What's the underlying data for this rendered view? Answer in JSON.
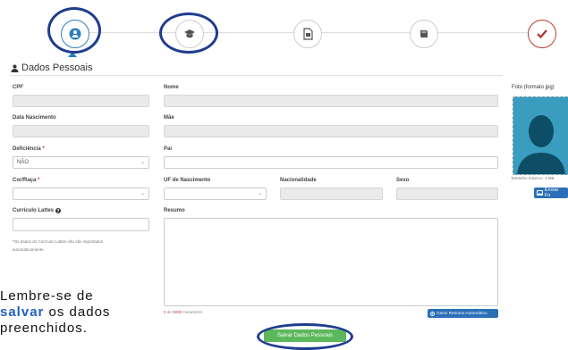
{
  "section": {
    "title": "Dados Pessoais"
  },
  "fields": {
    "cpf": {
      "label": "CPF"
    },
    "nome": {
      "label": "Nome"
    },
    "foto": {
      "label": "Foto (formato jpg)",
      "hint": "Tamanho máximo: 2 MB",
      "button": "Enviar Fo"
    },
    "data_nascimento": {
      "label": "Data Nascimento"
    },
    "mae": {
      "label": "Mãe"
    },
    "deficiencia": {
      "label": "Deficiência",
      "required": "*",
      "value": "NÃO"
    },
    "pai": {
      "label": "Pai"
    },
    "cor_raca": {
      "label": "Cor/Raça",
      "required": "*"
    },
    "uf_nascimento": {
      "label": "UF de Nascimento"
    },
    "nacionalidade": {
      "label": "Nacionalidade"
    },
    "sexo": {
      "label": "Sexo"
    },
    "lattes": {
      "label": "Currículo Lattes",
      "note_line1": "*Os dados do Currículo Lattes não são importados",
      "note_line2": "automaticamente."
    },
    "resumo": {
      "label": "Resumo",
      "counter_num": "0",
      "counter_de": "de",
      "counter_max": "5000",
      "counter_suffix": "Caracteres",
      "generate_button": "Gerar Resumo Automático"
    }
  },
  "save_button": "Salvar Dados Pessoais",
  "reminder": {
    "line1": "Lembre-se de",
    "highlight": "salvar",
    "line2_rest": "os dados",
    "line3": "preenchidos."
  },
  "steps": [
    {
      "icon": "user-icon",
      "active": true
    },
    {
      "icon": "graduation-cap-icon",
      "active": false
    },
    {
      "icon": "document-icon",
      "active": false
    },
    {
      "icon": "book-icon",
      "active": false
    },
    {
      "icon": "check-icon",
      "active": false
    }
  ],
  "colors": {
    "annotation": "#1f3d8f",
    "primary": "#2a6fb7",
    "success": "#5cb85c",
    "danger": "#c0392b"
  }
}
